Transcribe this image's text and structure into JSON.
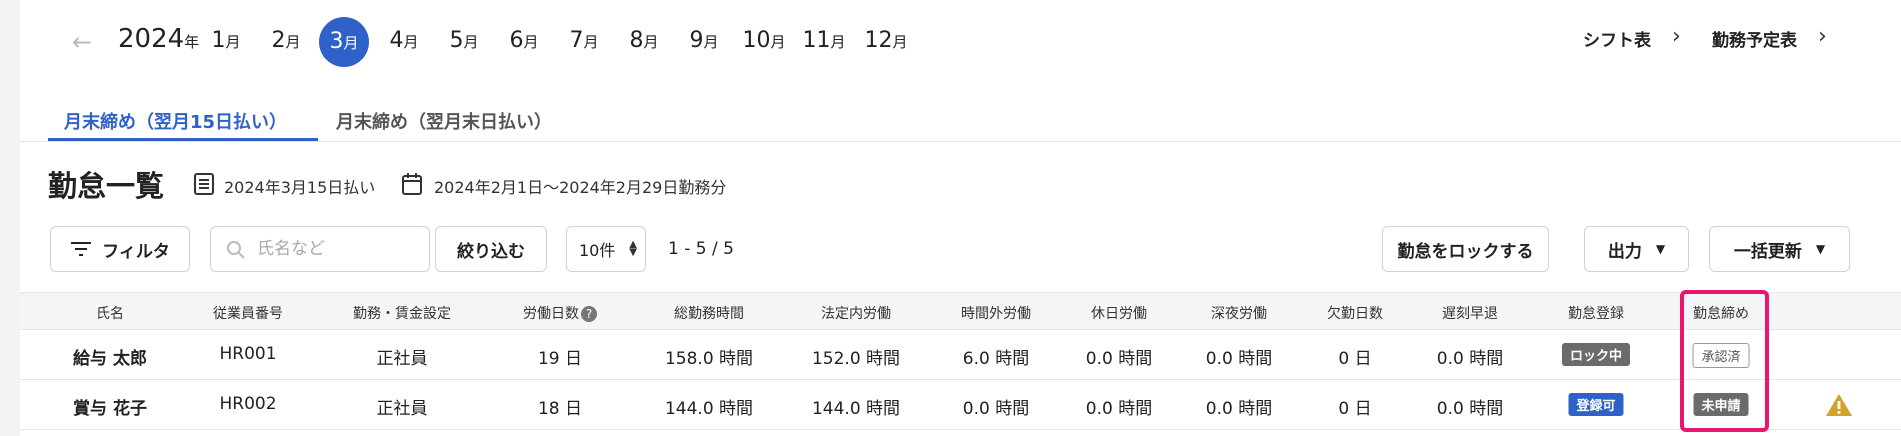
{
  "month_bar": {
    "year": "2024",
    "year_unit": "年",
    "month_unit": "月",
    "months": [
      "1",
      "2",
      "3",
      "4",
      "5",
      "6",
      "7",
      "8",
      "9",
      "10",
      "11",
      "12"
    ],
    "active_month": "3"
  },
  "top_links": {
    "shift": "シフト表",
    "schedule": "勤務予定表"
  },
  "tabs": [
    {
      "label": "月末締め（翌月15日払い）",
      "active": true
    },
    {
      "label": "月末締め（翌月末日払い）",
      "active": false
    }
  ],
  "page": {
    "title": "勤怠一覧",
    "pay_date": "2024年3月15日払い",
    "work_period": "2024年2月1日〜2024年2月29日勤務分"
  },
  "toolbar": {
    "filter_label": "フィルタ",
    "search_placeholder": "氏名など",
    "narrow_label": "絞り込む",
    "per_page": "10件",
    "paging": "1 - 5 / 5",
    "lock_label": "勤怠をロックする",
    "export_label": "出力",
    "bulk_update_label": "一括更新"
  },
  "table": {
    "columns": [
      "氏名",
      "従業員番号",
      "勤務・賃金設定",
      "労働日数",
      "総勤務時間",
      "法定内労働",
      "時間外労働",
      "休日労働",
      "深夜労働",
      "欠勤日数",
      "遅刻早退",
      "勤怠登録",
      "勤怠締め"
    ],
    "help_symbol": "?",
    "rows": [
      {
        "name": "給与 太郎",
        "emp_no": "HR001",
        "setting": "正社員",
        "days": "19 日",
        "total": "158.0 時間",
        "legal": "152.0 時間",
        "overtime": "6.0 時間",
        "holiday": "0.0 時間",
        "night": "0.0 時間",
        "absent": "0 日",
        "late": "0.0 時間",
        "registration": "ロック中",
        "closing": "承認済",
        "warning": false
      },
      {
        "name": "賞与 花子",
        "emp_no": "HR002",
        "setting": "正社員",
        "days": "18 日",
        "total": "144.0 時間",
        "legal": "144.0 時間",
        "overtime": "0.0 時間",
        "holiday": "0.0 時間",
        "night": "0.0 時間",
        "absent": "0 日",
        "late": "0.0 時間",
        "registration": "登録可",
        "closing": "未申請",
        "warning": true
      }
    ]
  },
  "colors": {
    "accent": "#2f62c9",
    "highlight": "#e9156f",
    "warning": "#d4a22a",
    "badge_dark": "#6b6b6b"
  }
}
